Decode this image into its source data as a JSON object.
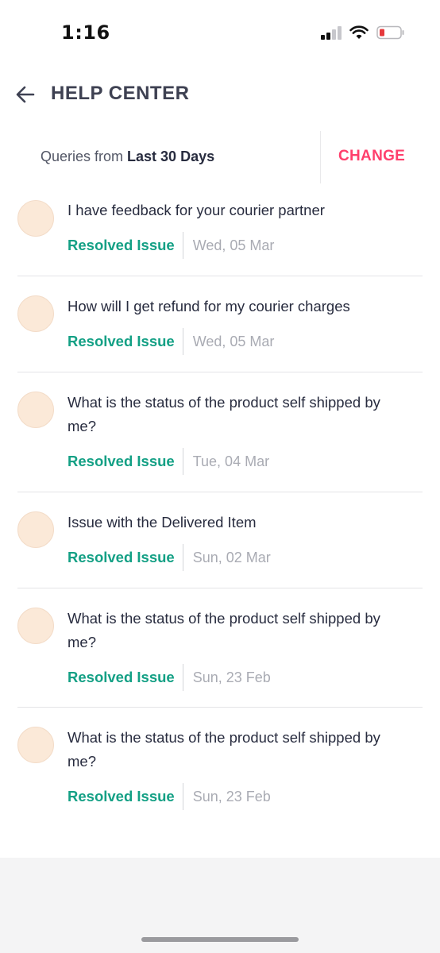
{
  "status_bar": {
    "time": "1:16",
    "signal_icon": "cellular-signal-icon",
    "wifi_icon": "wifi-icon",
    "battery_icon": "battery-low-icon",
    "battery_color": "#e5383b"
  },
  "header": {
    "back_icon": "arrow-left-icon",
    "title": "HELP CENTER"
  },
  "filter": {
    "prefix": "Queries from ",
    "value": "Last 30 Days",
    "change_label": "CHANGE"
  },
  "colors": {
    "accent": "#ff3f6c",
    "resolved": "#14a085",
    "avatar": "#fbe9d8"
  },
  "queries": [
    {
      "question": "I have feedback for your courier partner",
      "status": "Resolved Issue",
      "date": "Wed, 05 Mar"
    },
    {
      "question": "How will I get refund for my courier charges",
      "status": "Resolved Issue",
      "date": "Wed, 05 Mar"
    },
    {
      "question": "What is the status of the product self shipped by me?",
      "status": "Resolved Issue",
      "date": "Tue, 04 Mar"
    },
    {
      "question": "Issue with the Delivered Item",
      "status": "Resolved Issue",
      "date": "Sun, 02 Mar"
    },
    {
      "question": "What is the status of the product self shipped by me?",
      "status": "Resolved Issue",
      "date": "Sun, 23 Feb"
    },
    {
      "question": "What is the status of the product self shipped by me?",
      "status": "Resolved Issue",
      "date": "Sun, 23 Feb"
    }
  ]
}
